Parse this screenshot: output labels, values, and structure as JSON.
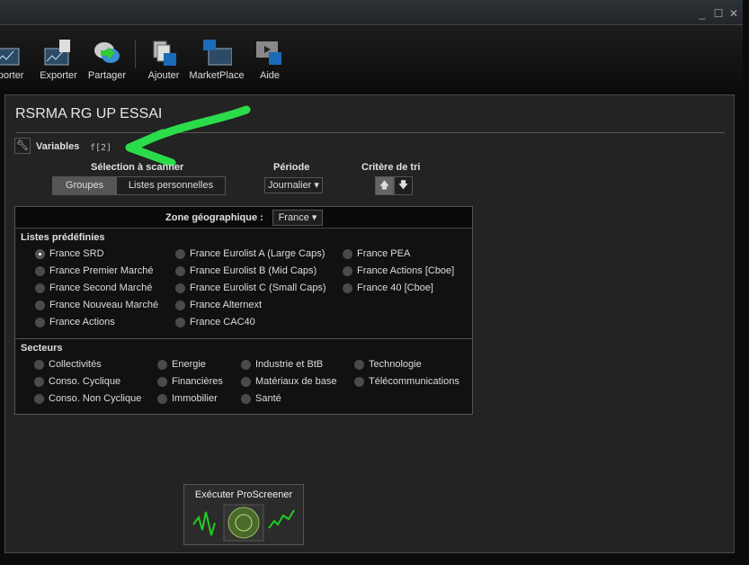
{
  "window": {
    "minimize": "_",
    "maximize": "☐",
    "close": "✕"
  },
  "toolbar": {
    "items": [
      {
        "label": "Importer"
      },
      {
        "label": "Exporter"
      },
      {
        "label": "Partager"
      },
      {
        "label": "Ajouter"
      },
      {
        "label": "MarketPlace"
      },
      {
        "label": "Aide"
      }
    ]
  },
  "screener": {
    "title": "RSRMA RG UP ESSAI",
    "variables_label": "Variables",
    "variables_code": "f[2]",
    "selection_label": "Sélection à scanner",
    "tabs": [
      "Groupes",
      "Listes personnelles"
    ],
    "period_label": "Période",
    "period_value": "Journalier",
    "sort_label": "Critère de tri",
    "sort_up": "🡅",
    "sort_down": "🡇",
    "zone_label": "Zone géographique :",
    "zone_value": "France",
    "predefined_title": "Listes prédéfinies",
    "predefined": [
      "France SRD",
      "France Premier Marché",
      "France Second Marché",
      "France Nouveau Marché",
      "France Actions",
      "France Eurolist A (Large Caps)",
      "France Eurolist B (Mid Caps)",
      "France Eurolist C (Small Caps)",
      "France Alternext",
      "France CAC40",
      "France PEA",
      "France Actions [Cboe]",
      "France 40 [Cboe]"
    ],
    "selected": "France SRD",
    "sectors_title": "Secteurs",
    "sectors": [
      "Collectivités",
      "Conso. Cyclique",
      "Conso. Non Cyclique",
      "Energie",
      "Financières",
      "Immobilier",
      "Industrie et BtB",
      "Matériaux de base",
      "Santé",
      "Technologie",
      "Télécommunications"
    ],
    "execute_label": "Exécuter ProScreener"
  }
}
